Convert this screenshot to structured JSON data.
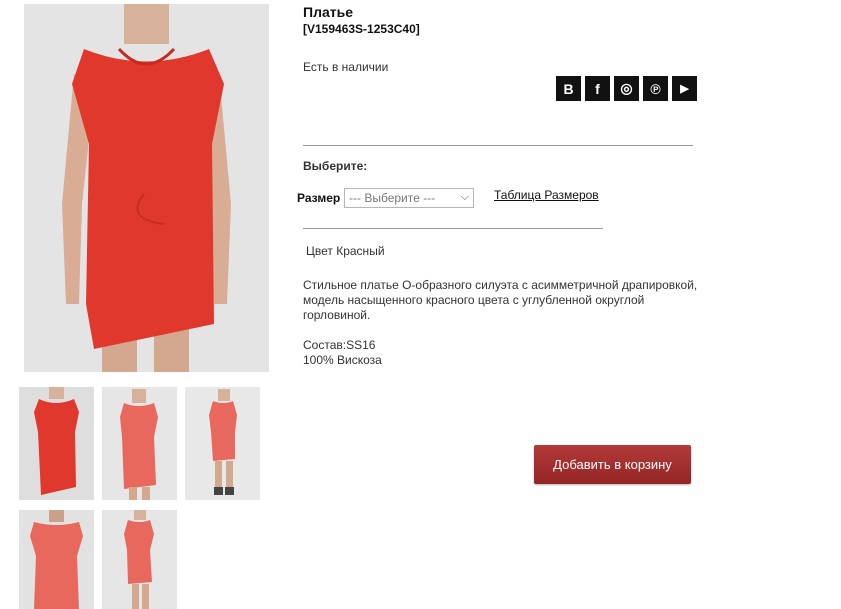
{
  "product": {
    "title": "Платье",
    "sku": "[V159463S-1253C40]",
    "availability": "Есть в наличии",
    "choose_label": "Выберите:",
    "size_label": "Размер",
    "size_select_value": "--- Выберите ---",
    "size_table_link": "Таблица Размеров",
    "color": "Цвет Красный",
    "description": "Стильное платье О-образного силуэта с асимметричной драпировкой, модель насыщенного красного цвета с углубленной округлой горловиной.",
    "composition_label": "Состав:SS16",
    "composition_value": "100% Вискоза",
    "add_to_cart": "Добавить в корзину"
  },
  "social": [
    {
      "icon": "vk-icon",
      "glyph": "B"
    },
    {
      "icon": "facebook-icon",
      "glyph": "f"
    },
    {
      "icon": "instagram-icon",
      "glyph": "◎"
    },
    {
      "icon": "pinterest-icon",
      "glyph": "℗"
    },
    {
      "icon": "youtube-icon",
      "glyph": "▶"
    }
  ],
  "colors": {
    "dress": "#e0382c",
    "dress_alt": "#e8685e",
    "cart_button": "#a82e2e"
  }
}
